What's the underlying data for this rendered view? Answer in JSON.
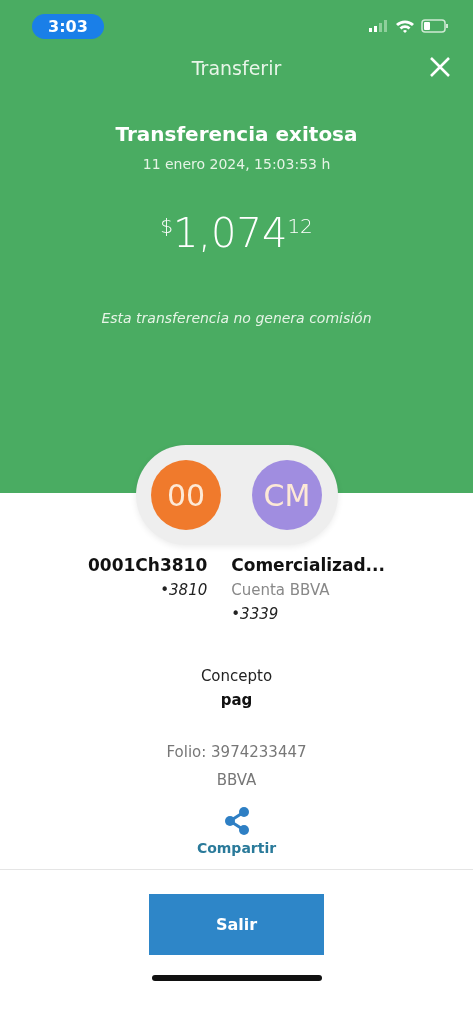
{
  "status_bar": {
    "time": "3:03"
  },
  "header": {
    "title": "Transferir"
  },
  "result": {
    "heading": "Transferencia exitosa",
    "date": "11 enero 2024, 15:03:53 h",
    "amount": {
      "currency": "$",
      "integer": "1,074",
      "cents": "12"
    },
    "note": "Esta transferencia no genera comisión"
  },
  "parties": [
    {
      "initials": "00",
      "color": "#f07a2c",
      "name": "0001Ch3810",
      "account": "•3810"
    },
    {
      "initials": "CM",
      "color": "#a08de0",
      "name": "Comercializad...",
      "bank": "Cuenta BBVA",
      "account": "•3339"
    }
  ],
  "concept": {
    "label": "Concepto",
    "value": "pag"
  },
  "folio": "Folio: 3974233447",
  "bank": "BBVA",
  "share": {
    "label": "Compartir"
  },
  "buttons": [
    {
      "label": "Salir"
    }
  ]
}
